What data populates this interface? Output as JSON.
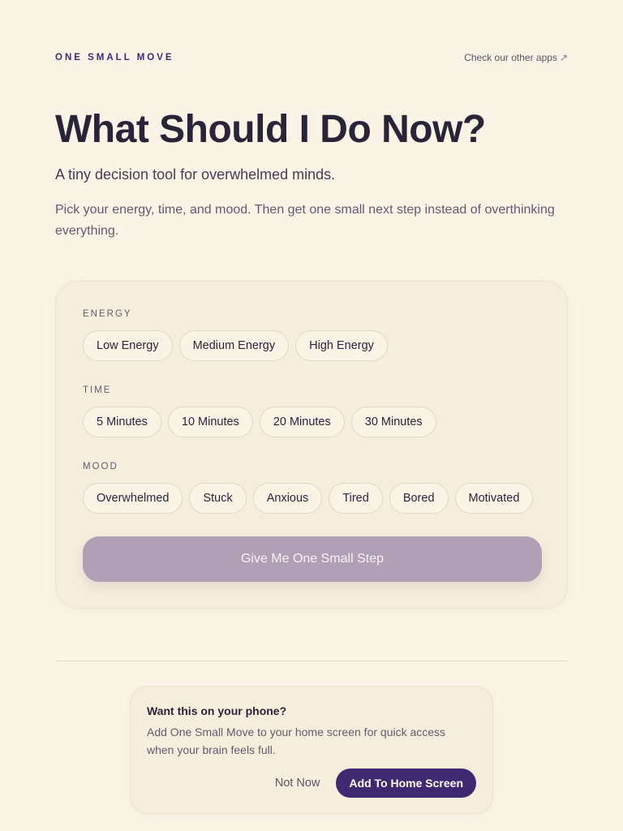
{
  "header": {
    "brand": "ONE SMALL MOVE",
    "other_apps_label": "Check our other apps",
    "other_apps_icon": "arrow-up-right-icon",
    "other_apps_glyph": "↗"
  },
  "hero": {
    "title": "What Should I Do Now?",
    "subtitle": "A tiny decision tool for overwhelmed minds.",
    "description": "Pick your energy, time, and mood. Then get one small next step instead of overthinking everything."
  },
  "selector": {
    "energy": {
      "label": "ENERGY",
      "options": [
        "Low Energy",
        "Medium Energy",
        "High Energy"
      ]
    },
    "time": {
      "label": "TIME",
      "options": [
        "5 Minutes",
        "10 Minutes",
        "20 Minutes",
        "30 Minutes"
      ]
    },
    "mood": {
      "label": "MOOD",
      "options": [
        "Overwhelmed",
        "Stuck",
        "Anxious",
        "Tired",
        "Bored",
        "Motivated"
      ]
    },
    "submit_label": "Give Me One Small Step"
  },
  "install_prompt": {
    "title": "Want this on your phone?",
    "description": "Add One Small Move to your home screen for quick access when your brain feels full.",
    "dismiss_label": "Not Now",
    "confirm_label": "Add To Home Screen"
  },
  "colors": {
    "background": "#faf4e6",
    "accent": "#3f2a72",
    "button_disabled": "#b09fb5",
    "card": "#f6eedd"
  }
}
